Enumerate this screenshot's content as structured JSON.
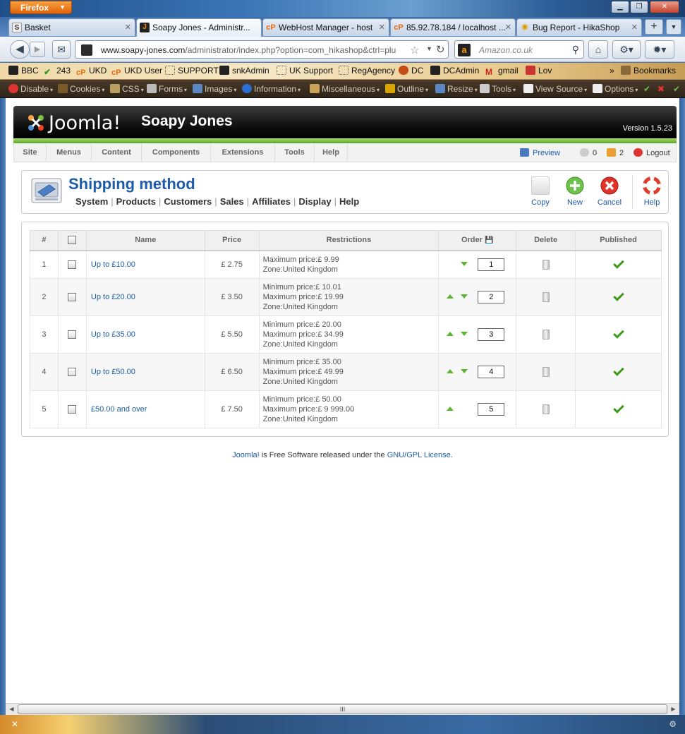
{
  "browser": {
    "app_button": "Firefox",
    "window_controls": {
      "minimize": "▁",
      "maximize": "❐",
      "close": "✕"
    },
    "tabs": [
      {
        "title": "Basket",
        "icon": "S"
      },
      {
        "title": "Soapy Jones - Administr...",
        "icon": "J"
      },
      {
        "title": "WebHost Manager - host",
        "icon": "cP"
      },
      {
        "title": "85.92.78.184 / localhost ...",
        "icon": "cP"
      },
      {
        "title": "Bug Report - HikaShop",
        "icon": "✷"
      }
    ],
    "new_tab": "+",
    "url": {
      "host": "www.soapy-jones.com",
      "path": "/administrator/index.php?option=com_hikashop&ctrl=plu"
    },
    "search_placeholder": "Amazon.co.uk",
    "bookmarks": [
      "BBC",
      "243",
      "UKD",
      "UKD User",
      "SUPPORT",
      "snkAdmin",
      "UK Support",
      "RegAgency",
      "DC",
      "DCAdmin",
      "gmail",
      "Lov"
    ],
    "bookmarks_overflow": "»",
    "bookmarks_menu": "Bookmarks",
    "dev_toolbar": [
      "Disable",
      "Cookies",
      "CSS",
      "Forms",
      "Images",
      "Information",
      "Miscellaneous",
      "Outline",
      "Resize",
      "Tools",
      "View Source",
      "Options"
    ]
  },
  "admin": {
    "logo_text": "Joomla!",
    "site_name": "Soapy Jones",
    "version": "Version 1.5.23",
    "menu": [
      "Site",
      "Menus",
      "Content",
      "Components",
      "Extensions",
      "Tools",
      "Help"
    ],
    "status": {
      "preview": "Preview",
      "messages_count": "0",
      "users_count": "2",
      "logout": "Logout"
    }
  },
  "page": {
    "title": "Shipping method",
    "submenu": [
      "System",
      "Products",
      "Customers",
      "Sales",
      "Affiliates",
      "Display",
      "Help"
    ],
    "toolbar": {
      "copy": "Copy",
      "new": "New",
      "cancel": "Cancel",
      "help": "Help"
    }
  },
  "table": {
    "columns": [
      "#",
      "",
      "Name",
      "Price",
      "Restrictions",
      "Order",
      "Delete",
      "Published"
    ],
    "rows": [
      {
        "num": "1",
        "name": "Up to £10.00",
        "price": "£ 2.75",
        "restrictions": [
          "Maximum price:£ 9.99",
          "Zone:United Kingdom"
        ],
        "order": "1",
        "up": false,
        "down": true,
        "published": true
      },
      {
        "num": "2",
        "name": "Up to £20.00",
        "price": "£ 3.50",
        "restrictions": [
          "Minimum price:£ 10.01",
          "Maximum price:£ 19.99",
          "Zone:United Kingdom"
        ],
        "order": "2",
        "up": true,
        "down": true,
        "published": true
      },
      {
        "num": "3",
        "name": "Up to £35.00",
        "price": "£ 5.50",
        "restrictions": [
          "Minimum price:£ 20.00",
          "Maximum price:£ 34.99",
          "Zone:United Kingdom"
        ],
        "order": "3",
        "up": true,
        "down": true,
        "published": true
      },
      {
        "num": "4",
        "name": "Up to £50.00",
        "price": "£ 6.50",
        "restrictions": [
          "Minimum price:£ 35.00",
          "Maximum price:£ 49.99",
          "Zone:United Kingdom"
        ],
        "order": "4",
        "up": true,
        "down": true,
        "published": true
      },
      {
        "num": "5",
        "name": "£50.00 and over",
        "price": "£ 7.50",
        "restrictions": [
          "Minimum price:£ 50.00",
          "Maximum price:£ 9 999.00",
          "Zone:United Kingdom"
        ],
        "order": "5",
        "up": true,
        "down": false,
        "published": true
      }
    ]
  },
  "footer": {
    "link1": "Joomla!",
    "middle": " is Free Software released under the ",
    "link2": "GNU/GPL License",
    "end": "."
  },
  "scrollbar": {
    "grip": "III"
  },
  "colors": {
    "joomla_blue": "#1e5ba8",
    "green_accent": "#5ca329",
    "header_black": "#111111"
  }
}
